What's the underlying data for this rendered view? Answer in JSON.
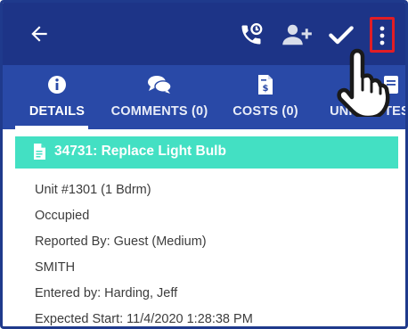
{
  "toolbar": {
    "icons": [
      "back-arrow-icon",
      "phone-callback-icon",
      "add-user-icon",
      "check-icon",
      "more-vert-icon"
    ],
    "accent_highlight": "#e21d24",
    "background": "#1d3487"
  },
  "tabs": [
    {
      "label": "DETAILS",
      "icon": "info-icon",
      "selected": true
    },
    {
      "label": "COMMENTS (0)",
      "icon": "chat-bubbles-icon",
      "selected": false
    },
    {
      "label": "COSTS (0)",
      "icon": "invoice-icon",
      "selected": false
    },
    {
      "label": "UNIT NOTES",
      "icon": "note-icon",
      "selected": false
    }
  ],
  "work_order": {
    "title": "34731: Replace Light Bulb",
    "banner_color": "#43e0c3"
  },
  "details": {
    "lines": [
      "Unit #1301 (1 Bdrm)",
      "Occupied",
      "Reported By: Guest  (Medium)",
      "SMITH",
      "Entered by: Harding, Jeff",
      "Expected Start: 11/4/2020 1:28:38 PM"
    ]
  }
}
